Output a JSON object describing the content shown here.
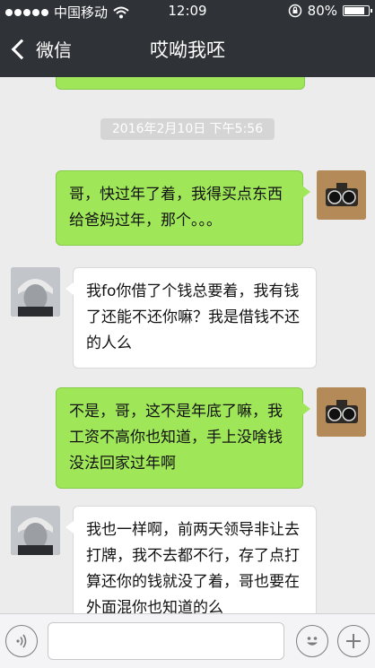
{
  "status_bar": {
    "carrier": "中国移动",
    "time": "12:09",
    "battery": "80%",
    "battery_level": 0.8
  },
  "nav": {
    "back_label": "微信",
    "title": "哎呦我呸"
  },
  "timestamp": "2016年2月10日 下午5:56",
  "messages": [
    {
      "from": "me",
      "text": "哥，快过年了着，我得买点东西给爸妈过年，那个。。。"
    },
    {
      "from": "other",
      "text": "我fo你借了个钱总要着，我有钱了还能不还你嘛？我是借钱不还的人么"
    },
    {
      "from": "me",
      "text": "不是，哥，这不是年底了嘛，我工资不高你也知道，手上没啥钱没法回家过年啊"
    },
    {
      "from": "other",
      "text": "我也一样啊，前两天领导非让去打牌，我不去都不行，存了点打算还你的钱就没了着，哥也要在外面混你也知道的么"
    }
  ],
  "input": {
    "value": "",
    "placeholder": ""
  },
  "icons": {
    "voice": "voice-icon",
    "emoji": "emoji-icon",
    "add": "plus-icon",
    "wifi": "wifi-icon",
    "lock": "rotation-lock-icon"
  },
  "colors": {
    "bar": "#2f3236",
    "sent_bubble": "#9fe759",
    "recv_bubble": "#ffffff",
    "background": "#ececec"
  }
}
